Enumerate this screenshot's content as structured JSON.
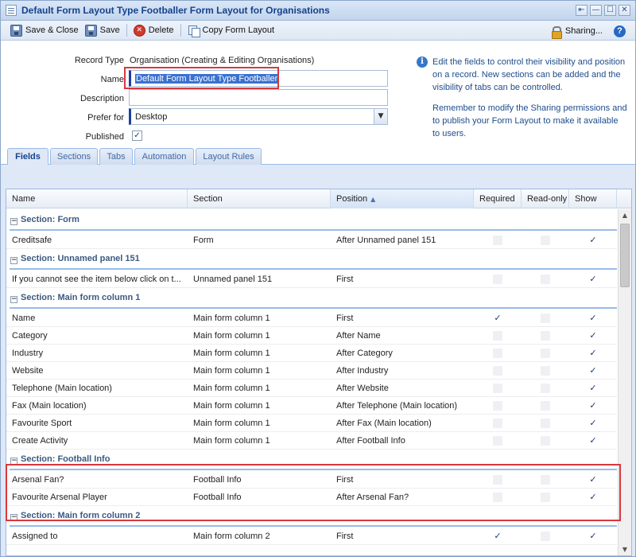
{
  "window": {
    "title": "Default Form Layout Type Footballer Form Layout for Organisations",
    "controls": [
      "⇤",
      "—",
      "☐",
      "✕"
    ]
  },
  "toolbar": {
    "save_close": "Save & Close",
    "save": "Save",
    "delete": "Delete",
    "copy_layout": "Copy Form Layout",
    "sharing": "Sharing...",
    "help": "?"
  },
  "form": {
    "record_type_label": "Record Type",
    "record_type_value": "Organisation (Creating & Editing Organisations)",
    "name_label": "Name",
    "name_value": "Default Form Layout Type Footballer",
    "description_label": "Description",
    "description_value": "",
    "prefer_for_label": "Prefer for",
    "prefer_for_value": "Desktop",
    "published_label": "Published",
    "published_checked": true
  },
  "info": {
    "icon": "i",
    "paragraph1": "Edit the fields to control their visibility and position on a record. New sections can be added and the visibility of tabs can be controlled.",
    "paragraph2": "Remember to modify the Sharing permissions and to publish your Form Layout to make it available to users."
  },
  "tabs": [
    "Fields",
    "Sections",
    "Tabs",
    "Automation",
    "Layout Rules"
  ],
  "active_tab": "Fields",
  "grid": {
    "columns": [
      "Name",
      "Section",
      "Position",
      "Required",
      "Read-only",
      "Show"
    ],
    "sorted_column": "Position",
    "sort_indicator": "▲",
    "groups": [
      {
        "title": "Section: Form",
        "rows": [
          {
            "name": "Creditsafe",
            "section": "Form",
            "position": "After Unnamed panel 151",
            "required": false,
            "readonly": false,
            "show": true
          }
        ]
      },
      {
        "title": "Section: Unnamed panel 151",
        "rows": [
          {
            "name": "If you cannot see the item below click on t...",
            "section": "Unnamed panel 151",
            "position": "First",
            "required": false,
            "readonly": false,
            "show": true
          }
        ]
      },
      {
        "title": "Section: Main form column 1",
        "rows": [
          {
            "name": "Name",
            "section": "Main form column 1",
            "position": "First",
            "required": true,
            "readonly": false,
            "show": true
          },
          {
            "name": "Category",
            "section": "Main form column 1",
            "position": "After Name",
            "required": false,
            "readonly": false,
            "show": true
          },
          {
            "name": "Industry",
            "section": "Main form column 1",
            "position": "After Category",
            "required": false,
            "readonly": false,
            "show": true
          },
          {
            "name": "Website",
            "section": "Main form column 1",
            "position": "After Industry",
            "required": false,
            "readonly": false,
            "show": true
          },
          {
            "name": "Telephone (Main location)",
            "section": "Main form column 1",
            "position": "After Website",
            "required": false,
            "readonly": false,
            "show": true
          },
          {
            "name": "Fax (Main location)",
            "section": "Main form column 1",
            "position": "After Telephone (Main location)",
            "required": false,
            "readonly": false,
            "show": true
          },
          {
            "name": "Favourite Sport",
            "section": "Main form column 1",
            "position": "After Fax (Main location)",
            "required": false,
            "readonly": false,
            "show": true
          },
          {
            "name": "Create Activity",
            "section": "Main form column 1",
            "position": "After Football Info",
            "required": false,
            "readonly": false,
            "show": true
          }
        ]
      },
      {
        "title": "Section: Football Info",
        "rows": [
          {
            "name": "Arsenal Fan?",
            "section": "Football Info",
            "position": "First",
            "required": false,
            "readonly": false,
            "show": true
          },
          {
            "name": "Favourite Arsenal Player",
            "section": "Football Info",
            "position": "After Arsenal Fan?",
            "required": false,
            "readonly": false,
            "show": true
          }
        ]
      },
      {
        "title": "Section: Main form column 2",
        "rows": [
          {
            "name": "Assigned to",
            "section": "Main form column 2",
            "position": "First",
            "required": true,
            "readonly": false,
            "show": true
          }
        ]
      }
    ]
  },
  "scrollbar": {
    "up": "▲",
    "down": "▼"
  }
}
